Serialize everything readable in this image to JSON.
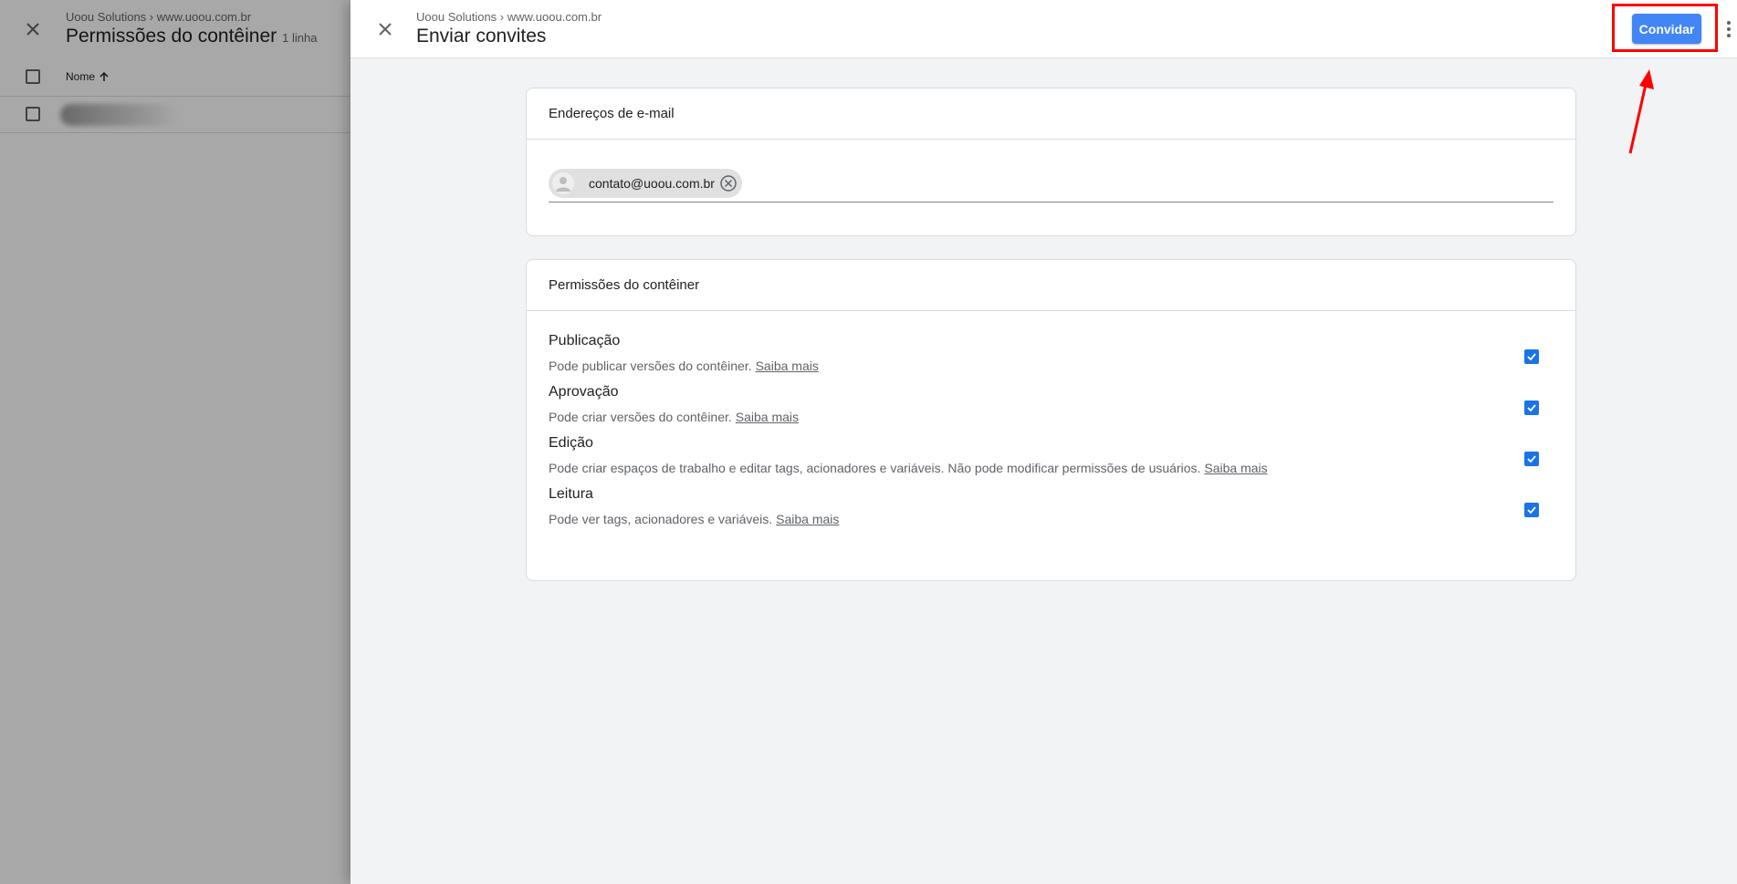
{
  "background_page": {
    "breadcrumb": "Uoou Solutions › www.uoou.com.br",
    "title": "Permissões do contêiner",
    "row_count": "1 linha",
    "column_name": "Nome"
  },
  "panel": {
    "breadcrumb": "Uoou Solutions › www.uoou.com.br",
    "title": "Enviar convites",
    "invite_label": "Convidar"
  },
  "emails": {
    "header": "Endereços de e-mail",
    "chips": [
      "contato@uoou.com.br"
    ]
  },
  "permissions": {
    "header": "Permissões do contêiner",
    "link_label": "Saiba mais",
    "items": [
      {
        "name": "Publicação",
        "description": "Pode publicar versões do contêiner.",
        "checked": true
      },
      {
        "name": "Aprovação",
        "description": "Pode criar versões do contêiner.",
        "checked": true
      },
      {
        "name": "Edição",
        "description": "Pode criar espaços de trabalho e editar tags, acionadores e variáveis. Não pode modificar permissões de usuários.",
        "checked": true
      },
      {
        "name": "Leitura",
        "description": "Pode ver tags, acionadores e variáveis.",
        "checked": true
      }
    ]
  },
  "colors": {
    "primary": "#4285f4",
    "checkbox": "#1a73e8",
    "annotation": "#ff0000",
    "panel_bg": "#f1f3f4"
  },
  "icons": [
    "close-icon",
    "arrow-up-icon",
    "person-icon",
    "cancel-icon",
    "more-vert-icon",
    "check-icon"
  ]
}
